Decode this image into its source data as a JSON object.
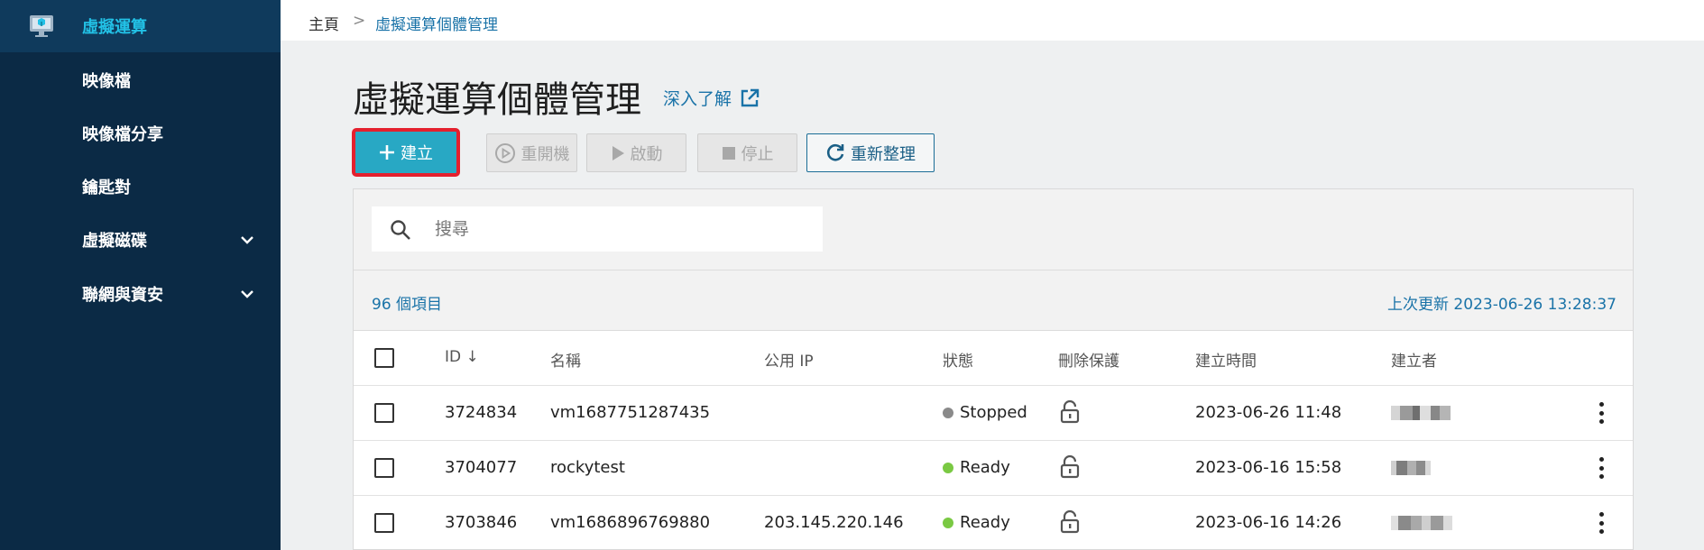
{
  "sidebar": {
    "items": [
      {
        "label": "虛擬運算",
        "active": true,
        "expandable": false
      },
      {
        "label": "映像檔",
        "active": false,
        "expandable": false
      },
      {
        "label": "映像檔分享",
        "active": false,
        "expandable": false
      },
      {
        "label": "鑰匙對",
        "active": false,
        "expandable": false
      },
      {
        "label": "虛擬磁碟",
        "active": false,
        "expandable": true
      },
      {
        "label": "聯網與資安",
        "active": false,
        "expandable": true
      }
    ]
  },
  "breadcrumb": {
    "home": "主頁",
    "separator": ">",
    "current": "虛擬運算個體管理"
  },
  "page": {
    "title": "虛擬運算個體管理",
    "learn_more": "深入了解"
  },
  "toolbar": {
    "create": "建立",
    "restart": "重開機",
    "start": "啟動",
    "stop": "停止",
    "refresh": "重新整理"
  },
  "search": {
    "placeholder": "搜尋"
  },
  "summary": {
    "count": "96 個項目",
    "last_updated": "上次更新 2023-06-26 13:28:37"
  },
  "table": {
    "columns": {
      "id": "ID",
      "name": "名稱",
      "public_ip": "公用 IP",
      "status": "狀態",
      "delete_protection": "刪除保護",
      "created_time": "建立時間",
      "creator": "建立者"
    },
    "sort_indicator": "↓",
    "rows": [
      {
        "id": "3724834",
        "name": "vm1687751287435",
        "public_ip": "",
        "status": "Stopped",
        "status_color": "#8a8a8a",
        "created_time": "2023-06-26 11:48"
      },
      {
        "id": "3704077",
        "name": "rockytest",
        "public_ip": "",
        "status": "Ready",
        "status_color": "#7ac943",
        "created_time": "2023-06-16 15:58"
      },
      {
        "id": "3703846",
        "name": "vm1686896769880",
        "public_ip": "203.145.220.146",
        "status": "Ready",
        "status_color": "#7ac943",
        "created_time": "2023-06-16 14:26"
      }
    ]
  },
  "colors": {
    "sidebar_bg": "#0b2a45",
    "accent": "#28a8c4",
    "link": "#1a73a8",
    "highlight": "#e4202e"
  }
}
